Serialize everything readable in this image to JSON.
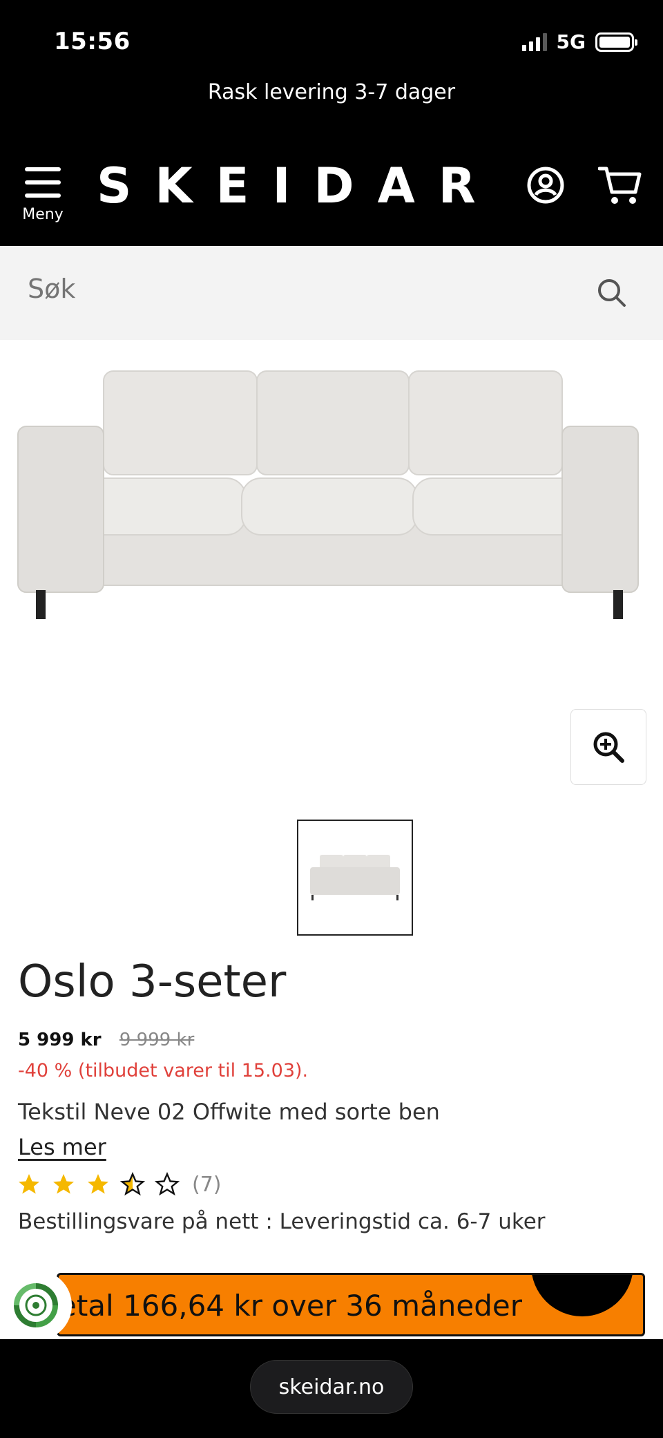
{
  "status_bar": {
    "time": "15:56",
    "network": "5G"
  },
  "header": {
    "promo": "Rask levering 3-7 dager",
    "menu_label": "Meny",
    "logo": "SKEIDAR",
    "icons": [
      "user-icon",
      "cart-icon",
      "hamburger-icon"
    ]
  },
  "search": {
    "placeholder": "Søk"
  },
  "product": {
    "title": "Oslo 3-seter",
    "price_now": "5 999 kr",
    "price_old": "9 999 kr",
    "discount": "-40 % (tilbudet varer til 15.03).",
    "description": "Tekstil Neve 02 Offwite med sorte ben",
    "read_more": "Les mer",
    "rating": {
      "stars": 3.5,
      "max": 5,
      "count": "(7)"
    },
    "delivery": "Bestillingsvare på nett : Leveringstid ca. 6-7 uker"
  },
  "finance": {
    "text": "etal 166,64 kr over 36 måneder"
  },
  "browser": {
    "url": "skeidar.no"
  },
  "colors": {
    "accent_orange": "#f77f00",
    "discount_red": "#e0413b",
    "star_yellow": "#f5b800"
  }
}
